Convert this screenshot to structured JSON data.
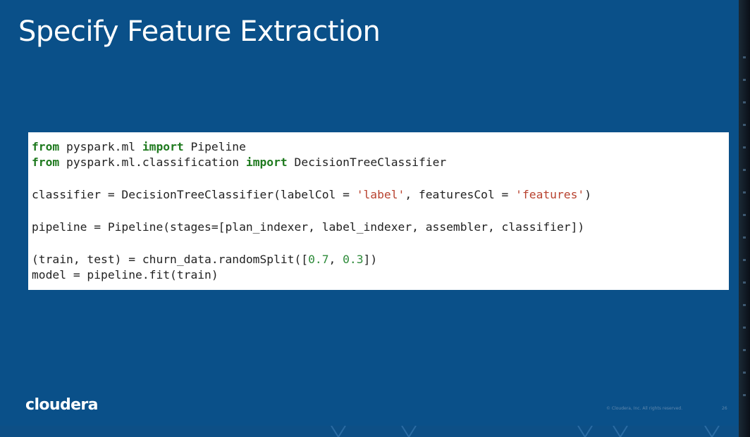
{
  "slide": {
    "title": "Specify Feature Extraction",
    "logo_text": "cloudera",
    "footer_text": "© Cloudera, Inc. All rights reserved.",
    "page_number": "26"
  },
  "code": {
    "l1": {
      "kw1": "from",
      "mod": " pyspark.ml ",
      "kw2": "import",
      "name": " Pipeline"
    },
    "l2": {
      "kw1": "from",
      "mod": " pyspark.ml.classification ",
      "kw2": "import",
      "name": " DecisionTreeClassifier"
    },
    "l3": {
      "pre": "classifier = DecisionTreeClassifier(labelCol = ",
      "s1": "'label'",
      "mid": ", featuresCol = ",
      "s2": "'features'",
      "post": ")"
    },
    "l4": {
      "text": "pipeline = Pipeline(stages=[plan_indexer, label_indexer, assembler, classifier])"
    },
    "l5": {
      "pre": "(train, test) = churn_data.randomSplit([",
      "n1": "0.7",
      "sep": ", ",
      "n2": "0.3",
      "post": "])"
    },
    "l6": {
      "text": "model = pipeline.fit(train)"
    }
  },
  "colors": {
    "slide_background": "#0a5089",
    "keyword": "#1f7a1f",
    "string": "#b8422f",
    "number": "#2e8b3a"
  }
}
